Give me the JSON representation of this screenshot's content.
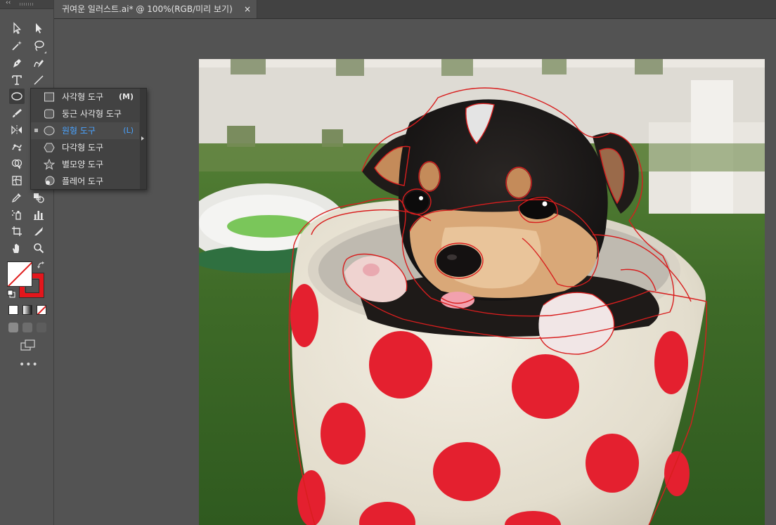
{
  "document_tab": {
    "title": "귀여운 일러스트.ai* @ 100%(RGB/미리 보기)",
    "close_glyph": "×"
  },
  "toolbar": {
    "collapse_glyph": "‹‹",
    "tools": [
      {
        "name": "selection-tool",
        "icon": "arrow-outline-icon"
      },
      {
        "name": "direct-selection-tool",
        "icon": "arrow-filled-icon"
      },
      {
        "name": "magic-wand-tool",
        "icon": "magic-wand-icon"
      },
      {
        "name": "lasso-tool",
        "icon": "lasso-icon"
      },
      {
        "name": "pen-tool",
        "icon": "pen-icon"
      },
      {
        "name": "curvature-tool",
        "icon": "curvature-pen-icon"
      },
      {
        "name": "type-tool",
        "icon": "type-icon"
      },
      {
        "name": "line-segment-tool",
        "icon": "line-icon"
      },
      {
        "name": "ellipse-tool",
        "icon": "ellipse-icon"
      },
      {
        "name": "paintbrush-tool",
        "icon": "brush-icon"
      },
      {
        "name": "reflect-tool",
        "icon": "reflect-icon"
      },
      {
        "name": "puppet-warp-tool",
        "icon": "puppet-warp-icon"
      },
      {
        "name": "shape-builder-tool",
        "icon": "shape-builder-icon"
      },
      {
        "name": "mesh-tool",
        "icon": "mesh-icon"
      },
      {
        "name": "eyedropper-tool",
        "icon": "eyedropper-icon"
      },
      {
        "name": "blend-tool",
        "icon": "blend-icon"
      },
      {
        "name": "symbol-sprayer-tool",
        "icon": "symbol-sprayer-icon"
      },
      {
        "name": "column-graph-tool",
        "icon": "bar-graph-icon"
      },
      {
        "name": "artboard-tool",
        "icon": "artboard-icon"
      },
      {
        "name": "slice-tool",
        "icon": "knife-icon"
      },
      {
        "name": "hand-tool",
        "icon": "hand-icon"
      },
      {
        "name": "zoom-tool",
        "icon": "zoom-icon"
      }
    ],
    "fill_color": "#ffffff",
    "stroke_color": "#e3161c",
    "more_glyph": "•••"
  },
  "flyout": {
    "items": [
      {
        "label": "사각형 도구",
        "shortcut": "(M)",
        "icon": "rectangle-icon",
        "selected": false
      },
      {
        "label": "둥근 사각형 도구",
        "shortcut": "",
        "icon": "rounded-rectangle-icon",
        "selected": false
      },
      {
        "label": "원형 도구",
        "shortcut": "(L)",
        "icon": "ellipse-icon",
        "selected": true
      },
      {
        "label": "다각형 도구",
        "shortcut": "",
        "icon": "polygon-icon",
        "selected": false
      },
      {
        "label": "별모양 도구",
        "shortcut": "",
        "icon": "star-icon",
        "selected": false
      },
      {
        "label": "플레어 도구",
        "shortcut": "",
        "icon": "flare-icon",
        "selected": false
      }
    ],
    "accent_color": "#4aa3ff"
  },
  "artboard": {
    "image_subject": "puppy-in-polka-dot-cup",
    "trace_stroke_color": "#d81e1e",
    "dot_color": "#e4202f"
  }
}
